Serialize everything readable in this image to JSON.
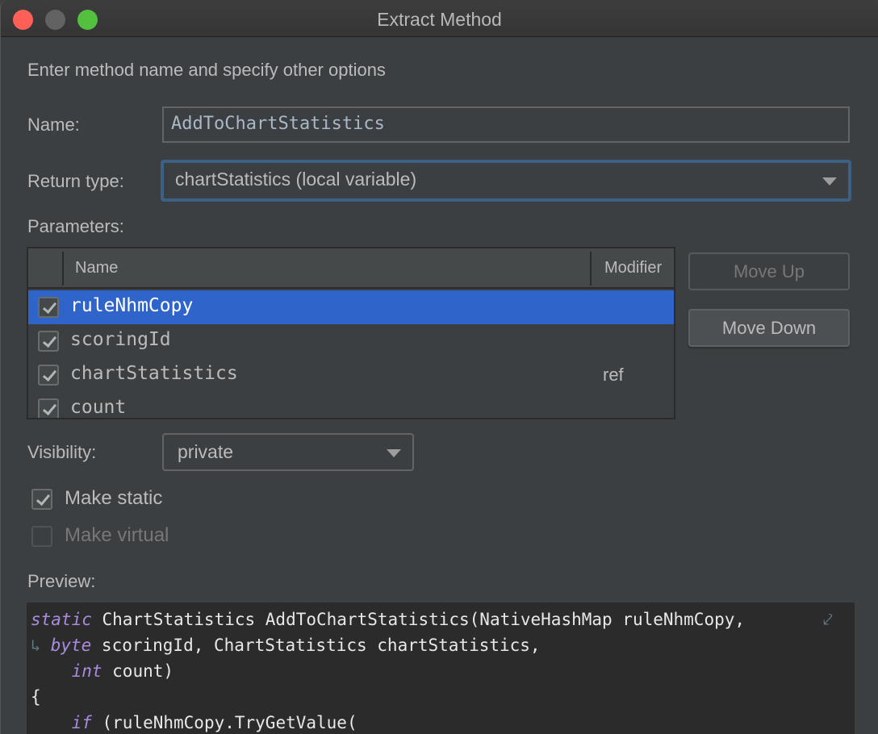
{
  "window": {
    "title": "Extract Method",
    "controls": [
      "close",
      "minimize",
      "maximize"
    ]
  },
  "intro": "Enter method name and specify other options",
  "name_field": {
    "label": "Name:",
    "value": "AddToChartStatistics"
  },
  "return_type": {
    "label": "Return type:",
    "selected": "chartStatistics (local variable)"
  },
  "parameters": {
    "label": "Parameters:",
    "columns": [
      "Name",
      "Modifier"
    ],
    "rows": [
      {
        "checked": true,
        "name": "ruleNhmCopy",
        "modifier": "",
        "selected": true
      },
      {
        "checked": true,
        "name": "scoringId",
        "modifier": "",
        "selected": false
      },
      {
        "checked": true,
        "name": "chartStatistics",
        "modifier": "ref",
        "selected": false
      },
      {
        "checked": true,
        "name": "count",
        "modifier": "",
        "selected": false
      }
    ],
    "move_up_label": "Move Up",
    "move_down_label": "Move Down"
  },
  "visibility": {
    "label": "Visibility:",
    "selected": "private"
  },
  "options": {
    "make_static": {
      "label": "Make static",
      "checked": true,
      "enabled": true
    },
    "make_virtual": {
      "label": "Make virtual",
      "checked": false,
      "enabled": false
    }
  },
  "preview": {
    "label": "Preview:",
    "lines": [
      {
        "kw": "static",
        "text": " ChartStatistics AddToChartStatistics(NativeHashMap ruleNhmCopy,",
        "wrap_end": true,
        "wrap_start": false,
        "indent": ""
      },
      {
        "kw": "byte",
        "text": " scoringId, ChartStatistics chartStatistics,",
        "wrap_end": false,
        "wrap_start": true,
        "indent": " "
      },
      {
        "kw": "int",
        "text": " count)",
        "wrap_end": false,
        "wrap_start": false,
        "indent": "    "
      },
      {
        "kw": "",
        "text": "{",
        "wrap_end": false,
        "wrap_start": false,
        "indent": ""
      },
      {
        "kw": "if",
        "text": " (ruleNhmCopy.TryGetValue(",
        "wrap_end": false,
        "wrap_start": false,
        "indent": "    "
      }
    ]
  },
  "colors": {
    "accent_selection": "#2f65ca",
    "focus_border": "#3d6185",
    "keyword": "#a98be0"
  }
}
